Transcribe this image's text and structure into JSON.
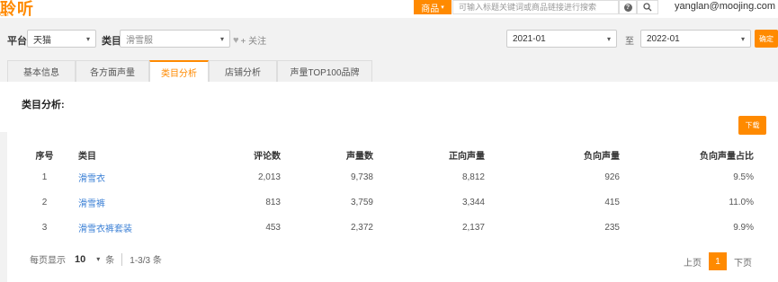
{
  "header": {
    "logo_text": "聆听",
    "logo_sub": "OM",
    "search_type": "商品",
    "search_placeholder": "可输入标题关键词或商品链接进行搜索",
    "user": "yanglan@moojing.com",
    "help_icon_text": "?"
  },
  "filters": {
    "platform_label": "平台",
    "platform_value": "天猫",
    "category_label": "类目",
    "category_value": "滑雪服",
    "follow_label": "+ 关注",
    "date_from": "2021-01",
    "to_label": "至",
    "date_to": "2022-01",
    "confirm_label": "确定"
  },
  "tabs": [
    {
      "label": "基本信息",
      "active": false
    },
    {
      "label": "各方面声量",
      "active": false
    },
    {
      "label": "类目分析",
      "active": true
    },
    {
      "label": "店铺分析",
      "active": false
    },
    {
      "label": "声量TOP100品牌",
      "active": false
    }
  ],
  "section": {
    "title": "类目分析:",
    "download_label": "下载"
  },
  "table": {
    "columns": [
      "序号",
      "类目",
      "评论数",
      "声量数",
      "正向声量",
      "负向声量",
      "负向声量占比"
    ],
    "rows": [
      [
        "1",
        "滑雪衣",
        "2,013",
        "9,738",
        "8,812",
        "926",
        "9.5%"
      ],
      [
        "2",
        "滑雪裤",
        "813",
        "3,759",
        "3,344",
        "415",
        "11.0%"
      ],
      [
        "3",
        "滑雪衣裤套装",
        "453",
        "2,372",
        "2,137",
        "235",
        "9.9%"
      ]
    ]
  },
  "pagination": {
    "per_page_label": "每页显示",
    "per_page_value": "10",
    "per_page_unit": "条",
    "range_text": "1-3/3 条",
    "prev_label": "上页",
    "current_page": "1",
    "next_label": "下页"
  },
  "colors": {
    "accent": "#ff8a00",
    "link": "#3a7fd5"
  }
}
